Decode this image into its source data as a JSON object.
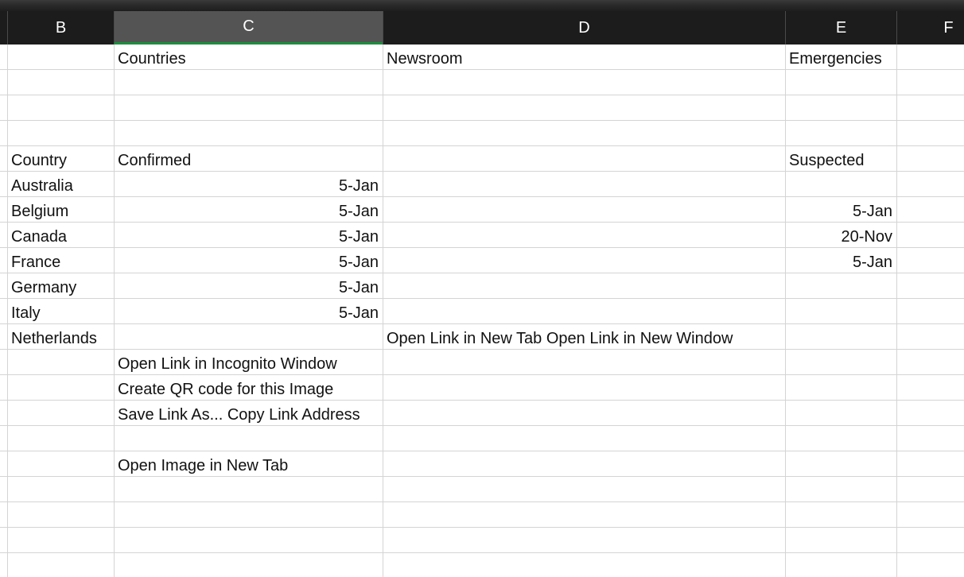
{
  "columns": [
    {
      "key": "B",
      "label": "B"
    },
    {
      "key": "C",
      "label": "C",
      "selected": true
    },
    {
      "key": "D",
      "label": "D"
    },
    {
      "key": "E",
      "label": "E"
    },
    {
      "key": "F",
      "label": "F"
    }
  ],
  "rows": [
    {
      "B": "",
      "C": "Countries",
      "D": "Newsroom",
      "E": "Emergencies"
    },
    {
      "B": "",
      "C": "",
      "D": "",
      "E": ""
    },
    {
      "B": "",
      "C": "",
      "D": "",
      "E": ""
    },
    {
      "B": "",
      "C": "",
      "D": "",
      "E": ""
    },
    {
      "B": "Country",
      "C": "Confirmed",
      "D": "",
      "E": "Suspected"
    },
    {
      "B": "Australia",
      "C": "5-Jan",
      "D": "",
      "E": ""
    },
    {
      "B": "Belgium",
      "C": "5-Jan",
      "D": "",
      "E": "5-Jan"
    },
    {
      "B": "Canada",
      "C": "5-Jan",
      "D": "",
      "E": "20-Nov"
    },
    {
      "B": "France",
      "C": "5-Jan",
      "D": "",
      "E": "5-Jan"
    },
    {
      "B": "Germany",
      "C": "5-Jan",
      "D": "",
      "E": ""
    },
    {
      "B": "Italy",
      "C": "5-Jan",
      "D": "",
      "E": ""
    },
    {
      "B": "Netherlands",
      "C": "",
      "D": "Open Link in New Tab Open Link in New Window",
      "E": ""
    },
    {
      "B": "",
      "C": "Open Link in Incognito Window",
      "D": "",
      "E": ""
    },
    {
      "B": "",
      "C": "Create QR code for this Image",
      "D": "",
      "E": ""
    },
    {
      "B": "",
      "C": "Save Link As... Copy Link Address",
      "D": "",
      "E": ""
    },
    {
      "B": "",
      "C": "",
      "D": "",
      "E": ""
    },
    {
      "B": "",
      "C": "Open Image in New Tab",
      "D": "",
      "E": ""
    }
  ],
  "numeric_columns": [
    "C",
    "E"
  ],
  "colors": {
    "header_bg": "#1c1c1c",
    "selected_header_bg": "#545454",
    "selected_accent": "#1e8e3e",
    "gridline": "#d4d4d4"
  }
}
